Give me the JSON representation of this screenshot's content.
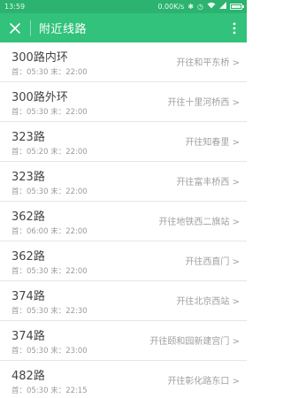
{
  "status_bar": {
    "time": "13:59",
    "network_speed": "0.00K/s",
    "battery_icon": "battery-icon"
  },
  "header": {
    "title": "附近线路",
    "close_icon": "close-icon",
    "more_icon": "more-vertical-icon"
  },
  "routes": [
    {
      "name": "300路内环",
      "times": "首：05:30 末：22:00",
      "dest": "开往和平东桥 >"
    },
    {
      "name": "300路外环",
      "times": "首：05:30 末：22:00",
      "dest": "开往十里河桥西 >"
    },
    {
      "name": "323路",
      "times": "首：05:20 末：22:00",
      "dest": "开往知春里 >"
    },
    {
      "name": "323路",
      "times": "首：05:30 末：22:00",
      "dest": "开往富丰桥西 >"
    },
    {
      "name": "362路",
      "times": "首：06:00 末：22:00",
      "dest": "开往地铁西二旗站 >"
    },
    {
      "name": "362路",
      "times": "首：05:30 末：22:00",
      "dest": "开往西直门 >"
    },
    {
      "name": "374路",
      "times": "首：05:30 末：22:30",
      "dest": "开往北京西站 >"
    },
    {
      "name": "374路",
      "times": "首：05:30 末：23:00",
      "dest": "开往颐和园新建宫门 >"
    },
    {
      "name": "482路",
      "times": "首：05:30 末：22:15",
      "dest": "开往彰化路东口 >"
    }
  ]
}
